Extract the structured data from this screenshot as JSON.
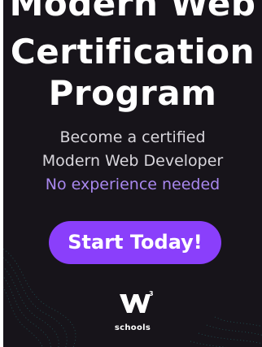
{
  "ad": {
    "headline_line1": "Modern Web",
    "headline_line2": "Certification",
    "headline_line3": "Program",
    "subtitle_line1": "Become a certified",
    "subtitle_line2": "Modern Web Developer",
    "highlight": "No experience needed",
    "cta_label": "Start Today!",
    "brand": {
      "superscript": "3",
      "name": "schools",
      "icon": "w3schools-logo-icon"
    },
    "decoration": "teal-particle-waves"
  },
  "colors": {
    "background": "#17141a",
    "accent": "#8a3ffb",
    "highlight_text": "#a887ee",
    "wave": "#2ec9c4"
  }
}
